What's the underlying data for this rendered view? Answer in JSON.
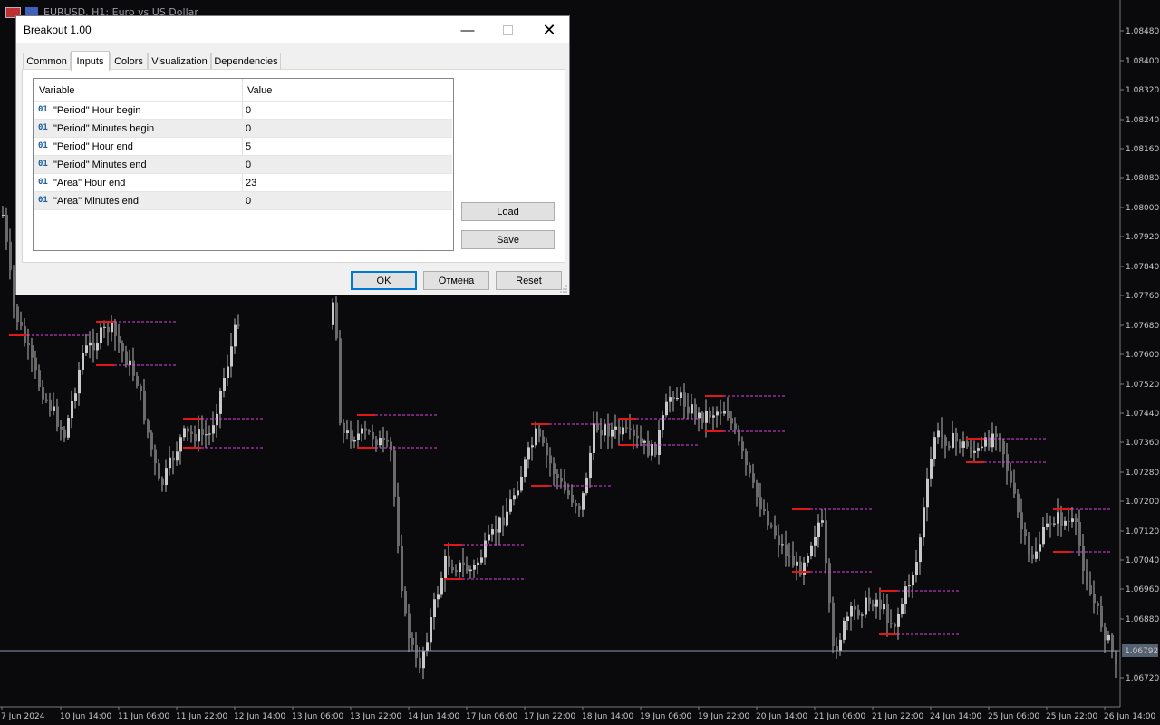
{
  "window": {
    "title": "EURUSD, H1:  Euro vs US Dollar"
  },
  "dialog": {
    "title": "Breakout 1.00",
    "tabs": [
      {
        "label": "Common",
        "active": false
      },
      {
        "label": "Inputs",
        "active": true
      },
      {
        "label": "Colors",
        "active": false
      },
      {
        "label": "Visualization",
        "active": false
      },
      {
        "label": "Dependencies",
        "active": false
      }
    ],
    "grid": {
      "col_variable": "Variable",
      "col_value": "Value",
      "rows": [
        {
          "type": "01",
          "variable": "\"Period\" Hour begin",
          "value": "0"
        },
        {
          "type": "01",
          "variable": "\"Period\" Minutes begin",
          "value": "0"
        },
        {
          "type": "01",
          "variable": "\"Period\" Hour end",
          "value": "5"
        },
        {
          "type": "01",
          "variable": "\"Period\" Minutes end",
          "value": "0"
        },
        {
          "type": "01",
          "variable": "\"Area\" Hour end",
          "value": "23"
        },
        {
          "type": "01",
          "variable": "\"Area\" Minutes end",
          "value": "0"
        }
      ]
    },
    "buttons": {
      "load": "Load",
      "save": "Save",
      "ok": "OK",
      "cancel": "Отмена",
      "reset": "Reset"
    }
  },
  "chart": {
    "symbol": "EURUSD",
    "timeframe": "H1",
    "current_price": "1.06792",
    "price_axis": [
      "1.08480",
      "1.08400",
      "1.08320",
      "1.08240",
      "1.08160",
      "1.08080",
      "1.08000",
      "1.07920",
      "1.07840",
      "1.07760",
      "1.07680",
      "1.07600",
      "1.07520",
      "1.07440",
      "1.07360",
      "1.07280",
      "1.07200",
      "1.07120",
      "1.07040",
      "1.06960",
      "1.06880",
      "1.06720"
    ],
    "time_axis": [
      "7 Jun 2024",
      "10 Jun 14:00",
      "11 Jun 06:00",
      "11 Jun 22:00",
      "12 Jun 14:00",
      "13 Jun 06:00",
      "13 Jun 22:00",
      "14 Jun 14:00",
      "17 Jun 06:00",
      "17 Jun 22:00",
      "18 Jun 14:00",
      "19 Jun 06:00",
      "19 Jun 22:00",
      "20 Jun 14:00",
      "21 Jun 06:00",
      "21 Jun 22:00",
      "24 Jun 14:00",
      "25 Jun 06:00",
      "25 Jun 22:00",
      "26 Jun 14:00"
    ],
    "colors": {
      "background": "#0a0a0d",
      "candle": "#b4b4b4",
      "breakout_level": "#e01818",
      "area_line": "#e040e0",
      "price_line": "#8899aa"
    }
  }
}
